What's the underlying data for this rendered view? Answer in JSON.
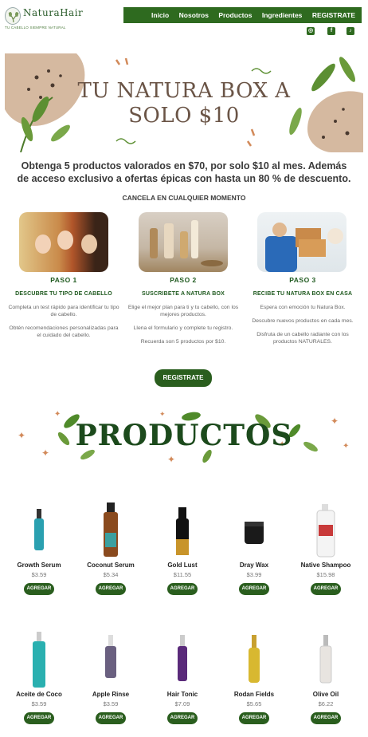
{
  "brand": {
    "name": "NaturaHair",
    "tagline": "TU CABELLO SIEMPRE NATURAL"
  },
  "nav": [
    "Inicio",
    "Nosotros",
    "Productos",
    "Ingredientes",
    "REGISTRATE"
  ],
  "social": [
    {
      "icon": "instagram-icon",
      "glyph": "◎"
    },
    {
      "icon": "facebook-icon",
      "glyph": "f"
    },
    {
      "icon": "tiktok-icon",
      "glyph": "♪"
    }
  ],
  "hero": {
    "line1": "TU NATURA BOX A",
    "line2": "SOLO $10"
  },
  "promo": "Obtenga 5 productos valorados en $70, por solo $10 al mes. Además de acceso exclusivo a ofertas épicas con hasta un 80 % de descuento.",
  "cancel": "CANCELA EN CUALQUIER MOMENTO",
  "steps": [
    {
      "num": "PASO 1",
      "title": "DESCUBRE TU TIPO DE CABELLO",
      "p1": "Completa un test rápido para identificar tu tipo de cabello.",
      "p2": "Obtén recomendaciones personalizadas para el cuidado del cabello.",
      "p3": ""
    },
    {
      "num": "PASO 2",
      "title": "SUSCRIBETE A NATURA BOX",
      "p1": "Elige el mejor plan para ti y tu cabello, con los mejores productos.",
      "p2": "Llena el formulario y complete tu registro.",
      "p3": "Recuerda son 5 productos por $10."
    },
    {
      "num": "PASO 3",
      "title": "RECIBE TU NATURA BOX EN CASA",
      "p1": "Espera con emoción tu Natura Box.",
      "p2": "Descubre nuevos productos en cada mes.",
      "p3": "Disfruta de un cabello radiante con los productos NATURALES."
    }
  ],
  "register_button": "REGISTRATE",
  "productos_title": "PRODUCTOS",
  "add_label": "AGREGAR",
  "products_row1": [
    {
      "name": "Growth Serum",
      "price": "$3.59"
    },
    {
      "name": "Coconut Serum",
      "price": "$5.34"
    },
    {
      "name": "Gold Lust",
      "price": "$11.55"
    },
    {
      "name": "Dray Wax",
      "price": "$3.99"
    },
    {
      "name": "Native Shampoo",
      "price": "$15.98"
    }
  ],
  "products_row2": [
    {
      "name": "Aceite de Coco",
      "price": "$3.59"
    },
    {
      "name": "Apple Rinse",
      "price": "$3.59"
    },
    {
      "name": "Hair Tonic",
      "price": "$7.09"
    },
    {
      "name": "Rodan Fields",
      "price": "$5.65"
    },
    {
      "name": "Olive Oil",
      "price": "$6.22"
    }
  ],
  "colors": {
    "brand_green": "#2e6a1f",
    "dark_green": "#1c4a1c",
    "hero_text": "#6a5446"
  }
}
